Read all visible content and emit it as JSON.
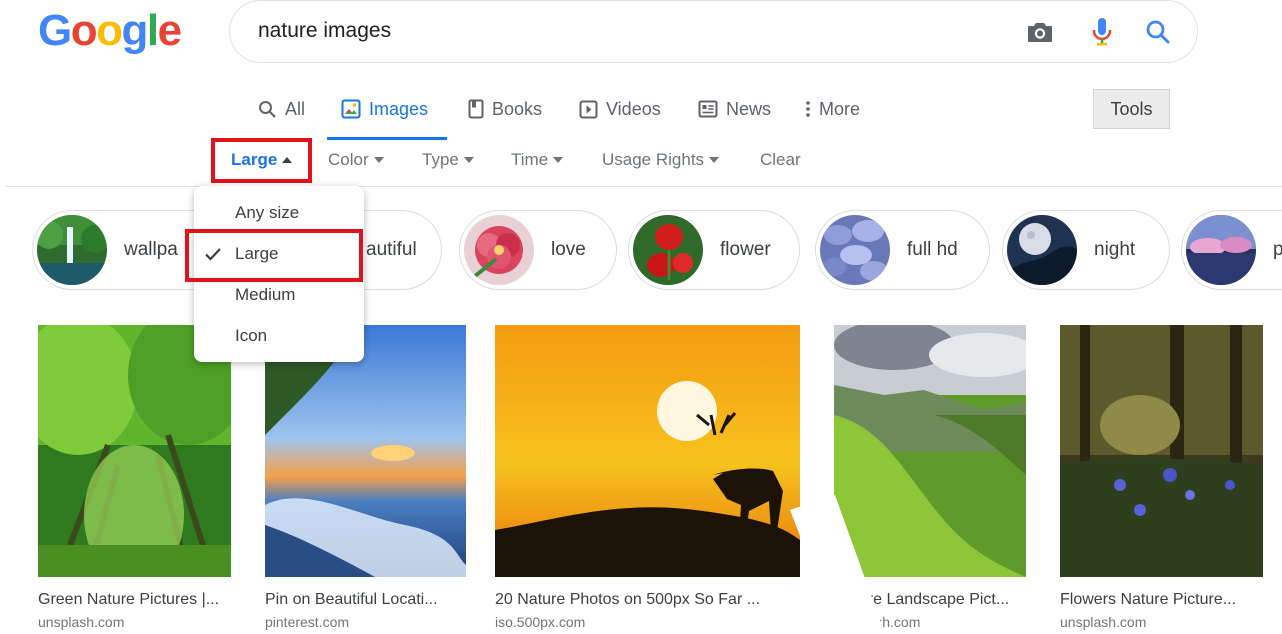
{
  "logo": {
    "letters": [
      "G",
      "o",
      "o",
      "g",
      "l",
      "e"
    ],
    "colors": [
      "#4285f4",
      "#ea4335",
      "#fbbc05",
      "#4285f4",
      "#34a853",
      "#ea4335"
    ]
  },
  "search": {
    "query": "nature images",
    "icons": [
      "camera-icon",
      "mic-icon",
      "search-icon"
    ]
  },
  "tabs": [
    {
      "label": "All",
      "icon": "search-icon"
    },
    {
      "label": "Images",
      "icon": "image-icon",
      "active": true
    },
    {
      "label": "Books",
      "icon": "book-icon"
    },
    {
      "label": "Videos",
      "icon": "play-icon"
    },
    {
      "label": "News",
      "icon": "newspaper-icon"
    },
    {
      "label": "More",
      "icon": "kebab-icon"
    }
  ],
  "tools_label": "Tools",
  "filters": {
    "size": "Large",
    "color": "Color",
    "type": "Type",
    "time": "Time",
    "usage_rights": "Usage Rights",
    "clear": "Clear"
  },
  "size_menu": {
    "items": [
      "Any size",
      "Large",
      "Medium",
      "Icon"
    ],
    "selected": "Large"
  },
  "chips": [
    "wallpaper",
    "beautiful",
    "love",
    "flower",
    "full hd",
    "night",
    "p"
  ],
  "chip_visible_text": [
    "wallpa",
    "autiful",
    "love",
    "flower",
    "full hd",
    "night",
    "p"
  ],
  "results": [
    {
      "title": "Green Nature Pictures |...",
      "source": "unsplash.com"
    },
    {
      "title": "Pin on Beautiful Locati...",
      "source": "pinterest.com"
    },
    {
      "title": "20 Nature Photos on 500px So Far ...",
      "source": "iso.500px.com"
    },
    {
      "title": "Nature Landscape Pict...",
      "source": "unsplash.com"
    },
    {
      "title": "Flowers Nature Picture...",
      "source": "unsplash.com"
    }
  ],
  "colors": {
    "accent": "#1a73e8",
    "highlight_box": "#e0121b"
  }
}
